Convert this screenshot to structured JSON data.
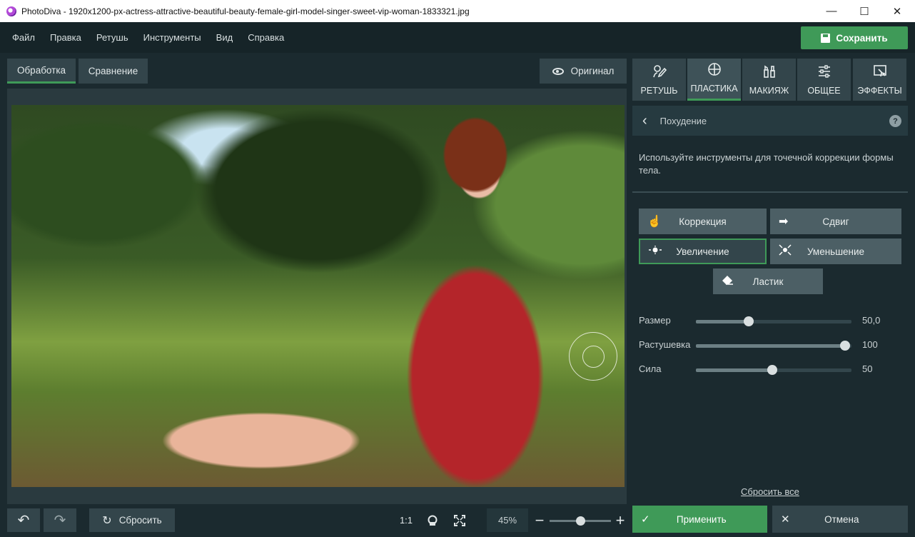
{
  "window": {
    "title": "PhotoDiva - 1920x1200-px-actress-attractive-beautiful-beauty-female-girl-model-singer-sweet-vip-woman-1833321.jpg",
    "minimize_glyph": "—",
    "maximize_glyph": "☐",
    "close_glyph": "✕"
  },
  "menu": {
    "items": [
      "Файл",
      "Правка",
      "Ретушь",
      "Инструменты",
      "Вид",
      "Справка"
    ],
    "save_label": "Сохранить"
  },
  "view": {
    "tabs": [
      "Обработка",
      "Сравнение"
    ],
    "active_tab": "Обработка",
    "original_label": "Оригинал"
  },
  "bottom": {
    "undo_glyph": "↶",
    "redo_glyph": "↷",
    "reset_label": "Сбросить",
    "reset_glyph": "↻",
    "fit_label": "1:1",
    "zoom_value": "45%",
    "zoom_minus": "−",
    "zoom_plus": "+",
    "zoom_fraction": 0.5
  },
  "panel": {
    "tabs": [
      {
        "label": "РЕТУШЬ",
        "icon": "retouch-icon"
      },
      {
        "label": "ПЛАСТИКА",
        "icon": "liquify-icon"
      },
      {
        "label": "МАКИЯЖ",
        "icon": "makeup-icon"
      },
      {
        "label": "ОБЩЕЕ",
        "icon": "adjust-icon"
      },
      {
        "label": "ЭФФЕКТЫ",
        "icon": "effects-icon"
      }
    ],
    "active_tab": "ПЛАСТИКА",
    "section_title": "Похудение",
    "help_glyph": "?",
    "description": "Используйте инструменты для точечной коррекции формы тела.",
    "tools": {
      "correction": "Коррекция",
      "shift": "Сдвиг",
      "enlarge": "Увеличение",
      "shrink": "Уменьшение",
      "eraser": "Ластик"
    },
    "active_tool": "Увеличение",
    "sliders": [
      {
        "label": "Размер",
        "value": "50,0",
        "fraction": 0.34
      },
      {
        "label": "Растушевка",
        "value": "100",
        "fraction": 0.96
      },
      {
        "label": "Сила",
        "value": "50",
        "fraction": 0.49
      }
    ],
    "reset_all": "Сбросить все",
    "apply_label": "Применить",
    "cancel_label": "Отмена"
  },
  "colors": {
    "accent": "#3f9a58",
    "background": "#1b2a2f",
    "panel_button": "#33454b"
  }
}
